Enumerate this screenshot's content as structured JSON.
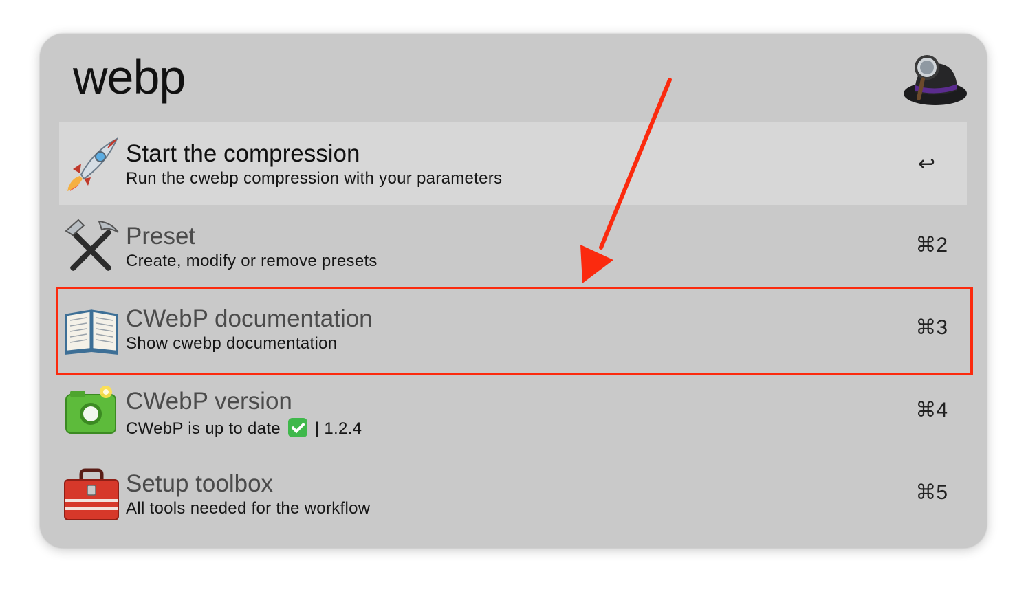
{
  "search": {
    "query": "webp"
  },
  "app": {
    "logo_icon": "alfred-hat-icon"
  },
  "results": [
    {
      "title": "Start the compression",
      "subtitle": "Run the cwebp compression with your parameters",
      "shortcut": "↩",
      "icon": "rocket-icon",
      "selected": true
    },
    {
      "title": "Preset",
      "subtitle": "Create, modify or remove presets",
      "shortcut": "⌘2",
      "icon": "hammer-pick-icon",
      "selected": false
    },
    {
      "title": "CWebP documentation",
      "subtitle": "Show cwebp documentation",
      "shortcut": "⌘3",
      "icon": "open-book-icon",
      "selected": false
    },
    {
      "title": "CWebP version",
      "subtitle_prefix": "CWebP is up to date",
      "subtitle_suffix": "| 1.2.4",
      "subtitle_icon": "check-mark-button-icon",
      "shortcut": "⌘4",
      "icon": "camera-icon",
      "selected": false
    },
    {
      "title": "Setup toolbox",
      "subtitle": "All tools needed for the workflow",
      "shortcut": "⌘5",
      "icon": "toolbox-icon",
      "selected": false
    }
  ],
  "annotation": {
    "highlighted_item": "CWebP documentation",
    "color": "#fb2a0e"
  },
  "colors": {
    "window_bg": "#c9c9c9",
    "selected_row_bg": "#d7d7d7"
  }
}
